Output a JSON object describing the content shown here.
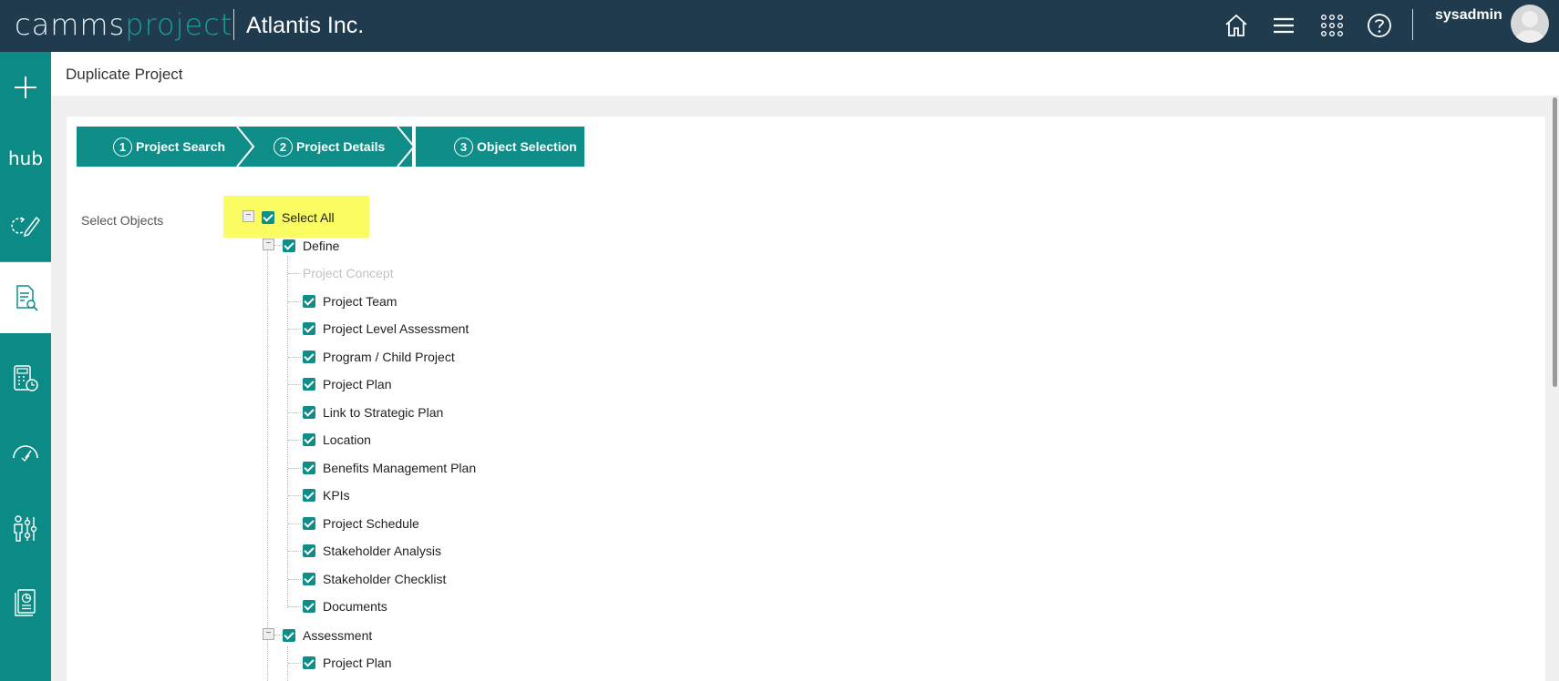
{
  "header": {
    "logo_part1": "camms",
    "logo_part2": "project",
    "company": "Atlantis Inc.",
    "username": "sysadmin",
    "icons": [
      "home-icon",
      "menu-icon",
      "apps-grid-icon",
      "help-icon"
    ]
  },
  "sidebar": {
    "items": [
      "add-icon",
      "hub",
      "plan-edit-icon",
      "project-search-icon",
      "calculator-clock-icon",
      "gauge-icon",
      "people-settings-icon",
      "report-icon"
    ],
    "hub_label": "hub"
  },
  "page": {
    "title": "Duplicate Project"
  },
  "wizard": {
    "steps": [
      {
        "num": "1",
        "label": "Project Search"
      },
      {
        "num": "2",
        "label": "Project Details"
      },
      {
        "num": "3",
        "label": "Object Selection"
      }
    ]
  },
  "selection": {
    "label": "Select Objects",
    "select_all": "Select All",
    "groups": [
      {
        "label": "Define",
        "checked": true,
        "items": [
          {
            "label": "Project Concept",
            "checked": false,
            "disabled": true
          },
          {
            "label": "Project Team",
            "checked": true
          },
          {
            "label": "Project Level Assessment",
            "checked": true
          },
          {
            "label": "Program / Child Project",
            "checked": true
          },
          {
            "label": "Project Plan",
            "checked": true
          },
          {
            "label": "Link to Strategic Plan",
            "checked": true
          },
          {
            "label": "Location",
            "checked": true
          },
          {
            "label": "Benefits Management Plan",
            "checked": true
          },
          {
            "label": "KPIs",
            "checked": true
          },
          {
            "label": "Project Schedule",
            "checked": true
          },
          {
            "label": "Stakeholder Analysis",
            "checked": true
          },
          {
            "label": "Stakeholder Checklist",
            "checked": true
          },
          {
            "label": "Documents",
            "checked": true
          }
        ]
      },
      {
        "label": "Assessment",
        "checked": true,
        "items": [
          {
            "label": "Project Plan",
            "checked": true
          }
        ]
      }
    ]
  },
  "colors": {
    "header_bg": "#1f3b4d",
    "accent": "#0f8d88",
    "highlight": "#fbfb62"
  }
}
